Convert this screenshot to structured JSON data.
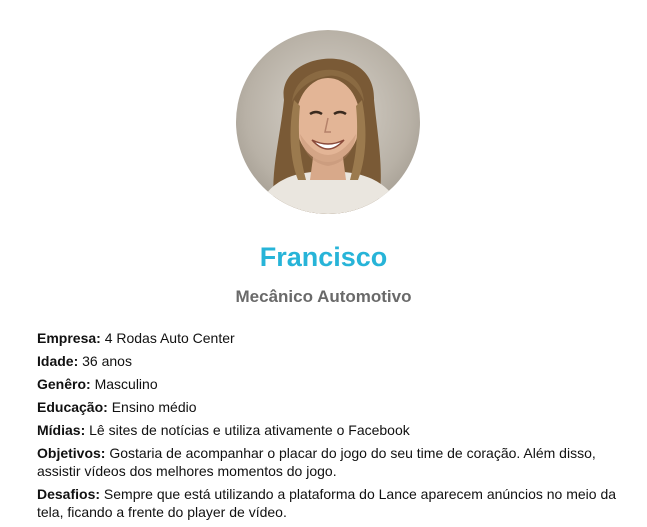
{
  "persona": {
    "photo_icon": "person-portrait",
    "name": "Francisco",
    "role": "Mecânico Automotivo",
    "name_color": "#27b4d8",
    "fields": [
      {
        "label": "Empresa:",
        "value": "4 Rodas Auto Center"
      },
      {
        "label": "Idade:",
        "value": "36 anos"
      },
      {
        "label": "Genêro:",
        "value": "Masculino"
      },
      {
        "label": "Educação:",
        "value": "Ensino médio"
      },
      {
        "label": "Mídias:",
        "value": "Lê sites de notícias e utiliza ativamente o Facebook"
      },
      {
        "label": "Objetivos:",
        "value": "Gostaria de acompanhar o placar do jogo do seu time de coração. Além disso, assistir vídeos dos melhores momentos do jogo."
      },
      {
        "label": "Desafios:",
        "value": "Sempre que está utilizando a plataforma do Lance aparecem anúncios no meio da tela, ficando a frente do player de vídeo."
      }
    ]
  }
}
